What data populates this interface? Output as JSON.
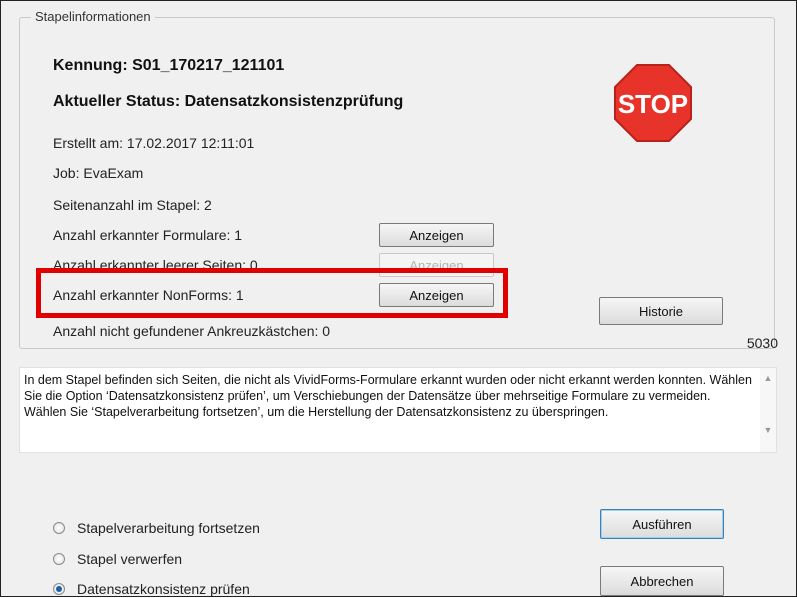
{
  "group": {
    "title": "Stapelinformationen"
  },
  "stapel": {
    "kennung": "Kennung: S01_170217_121101",
    "status": "Aktueller Status: Datensatzkonsistenzprüfung",
    "erstellt": "Erstellt am: 17.02.2017 12:11:01",
    "job": "Job: EvaExam",
    "seitenanzahl": "Seitenanzahl im Stapel: 2",
    "formulare": "Anzahl erkannter Formulare: 1",
    "leere_seiten": "Anzahl erkannter leerer Seiten: 0",
    "nonforms": "Anzahl erkannter NonForms: 1",
    "ankreuz": "Anzahl nicht gefundener Ankreuzkästchen: 0",
    "code": "5030"
  },
  "stop_sign": {
    "label": "STOP",
    "color": "#e8332a"
  },
  "buttons": {
    "anzeigen": "Anzeigen",
    "historie": "Historie",
    "ausfuehren": "Ausführen",
    "abbrechen": "Abbrechen"
  },
  "message": "In dem Stapel befinden sich Seiten, die nicht als VividForms-Formulare erkannt wurden oder nicht erkannt werden konnten. Wählen Sie die Option ‘Datensatzkonsistenz prüfen’, um Verschiebungen der Datensätze über mehrseitige Formulare zu vermeiden. Wählen Sie ‘Stapelverarbeitung fortsetzen’, um die Herstellung der Datensatzkonsistenz zu überspringen.",
  "options": [
    {
      "label": "Stapelverarbeitung fortsetzen",
      "checked": false
    },
    {
      "label": "Stapel verwerfen",
      "checked": false
    },
    {
      "label": "Datensatzkonsistenz prüfen",
      "checked": true
    }
  ],
  "highlight_color": "#e00000"
}
